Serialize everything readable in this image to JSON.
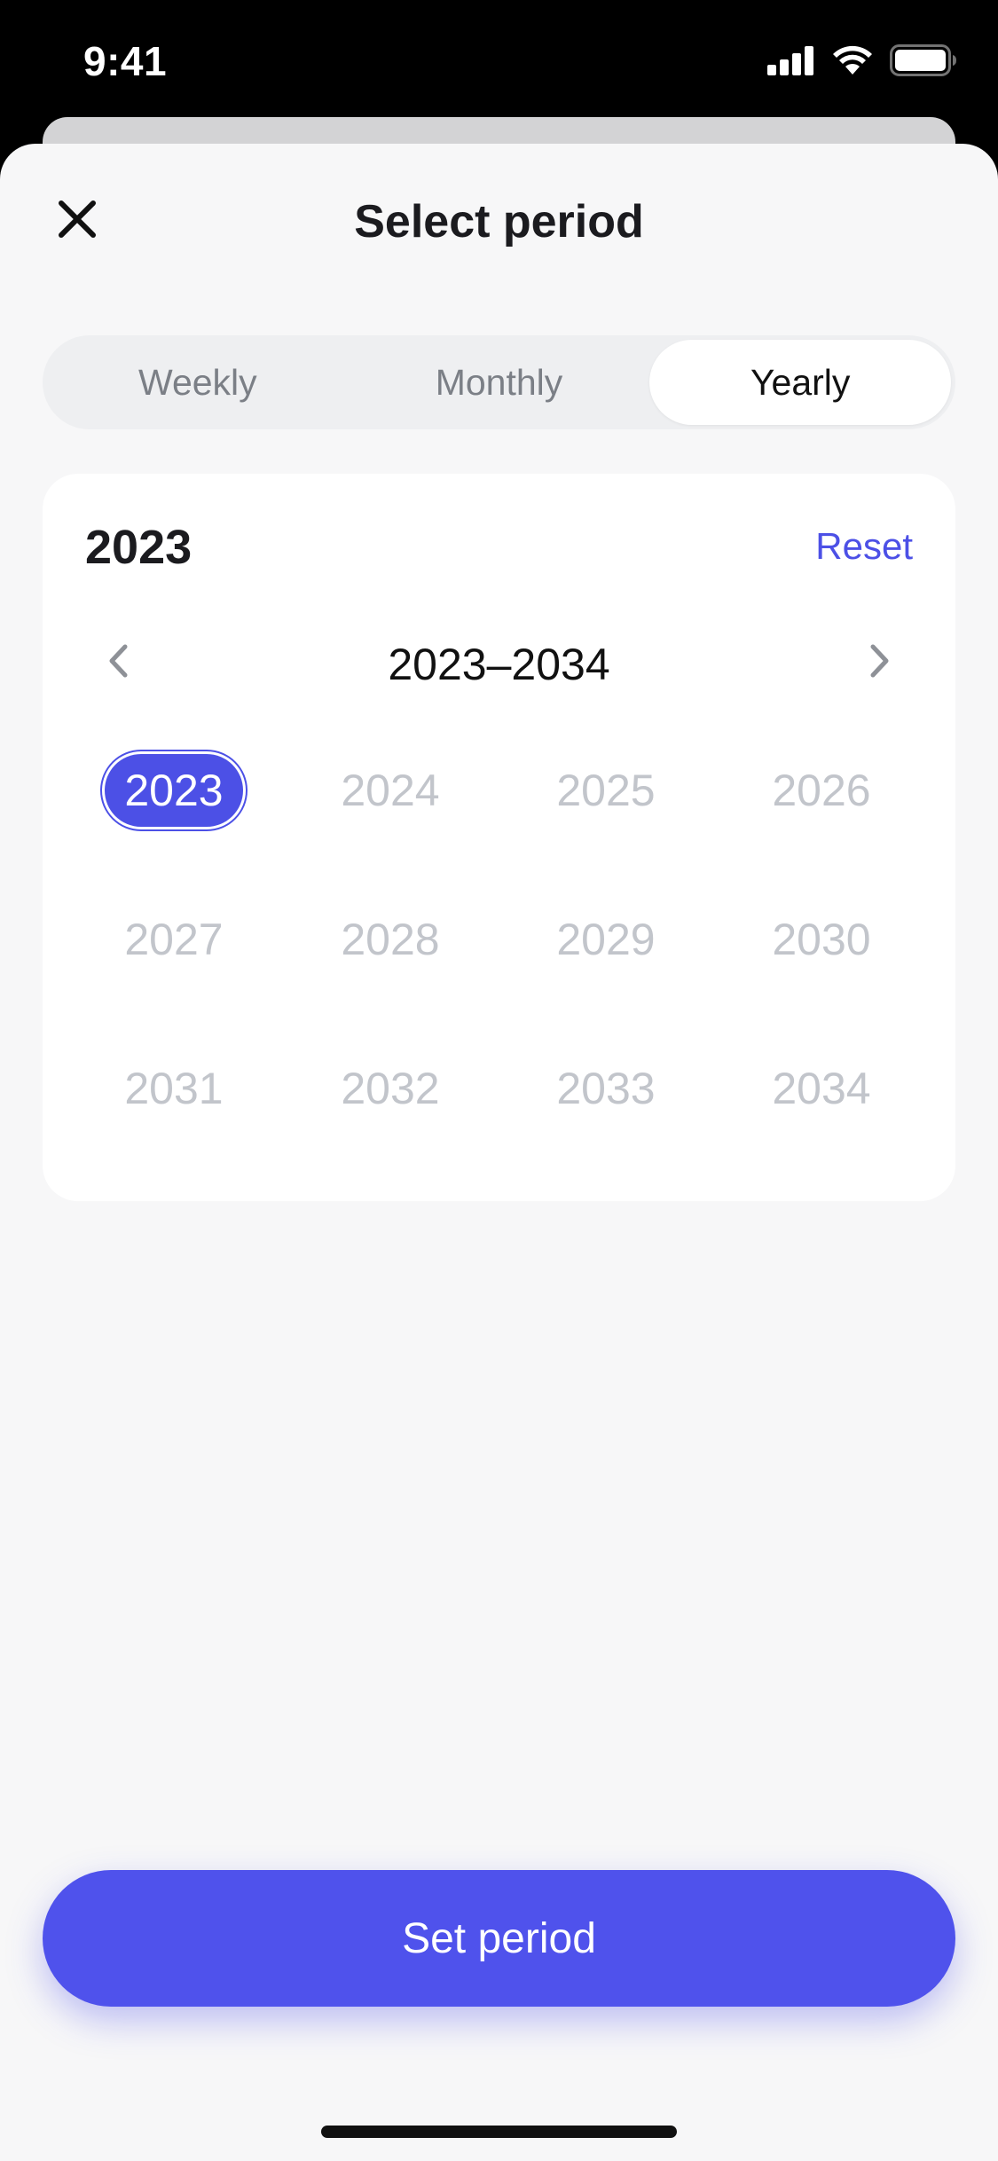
{
  "status_bar": {
    "time": "9:41"
  },
  "sheet": {
    "title": "Select period",
    "tabs": [
      {
        "label": "Weekly",
        "active": false
      },
      {
        "label": "Monthly",
        "active": false
      },
      {
        "label": "Yearly",
        "active": true
      }
    ]
  },
  "calendar": {
    "selected_year": "2023",
    "reset_label": "Reset",
    "range_label": "2023–2034",
    "years": [
      "2023",
      "2024",
      "2025",
      "2026",
      "2027",
      "2028",
      "2029",
      "2030",
      "2031",
      "2032",
      "2033",
      "2034"
    ],
    "selected_index": 0
  },
  "primary_button": {
    "label": "Set period"
  },
  "colors": {
    "accent": "#4c50e6",
    "button": "#4f52ec",
    "inactive_year": "#c2c5cb",
    "sheet_bg": "#f7f7f8"
  },
  "icons": {
    "close": "close-icon",
    "prev": "chevron-left-icon",
    "next": "chevron-right-icon",
    "signal": "cellular-signal-icon",
    "wifi": "wifi-icon",
    "battery": "battery-icon"
  }
}
